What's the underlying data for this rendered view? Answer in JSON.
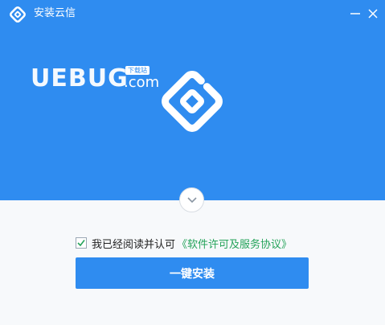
{
  "window": {
    "title": "安装云信",
    "minimize_icon": "minimize-icon",
    "close_icon": "close-icon"
  },
  "hero": {
    "background_color": "#2f8cf0",
    "watermark": {
      "main": "UEBUG",
      "suffix": ".com",
      "badge": "下载站"
    },
    "logo_icon": "yunxin-logo-icon"
  },
  "expand": {
    "icon": "chevron-down-icon"
  },
  "agreement": {
    "checked": true,
    "text": "我已经阅读并认可",
    "link": "《软件许可及服务协议》",
    "link_color": "#25a35a"
  },
  "install_button": {
    "label": "一键安装",
    "color": "#2f8cf0"
  }
}
